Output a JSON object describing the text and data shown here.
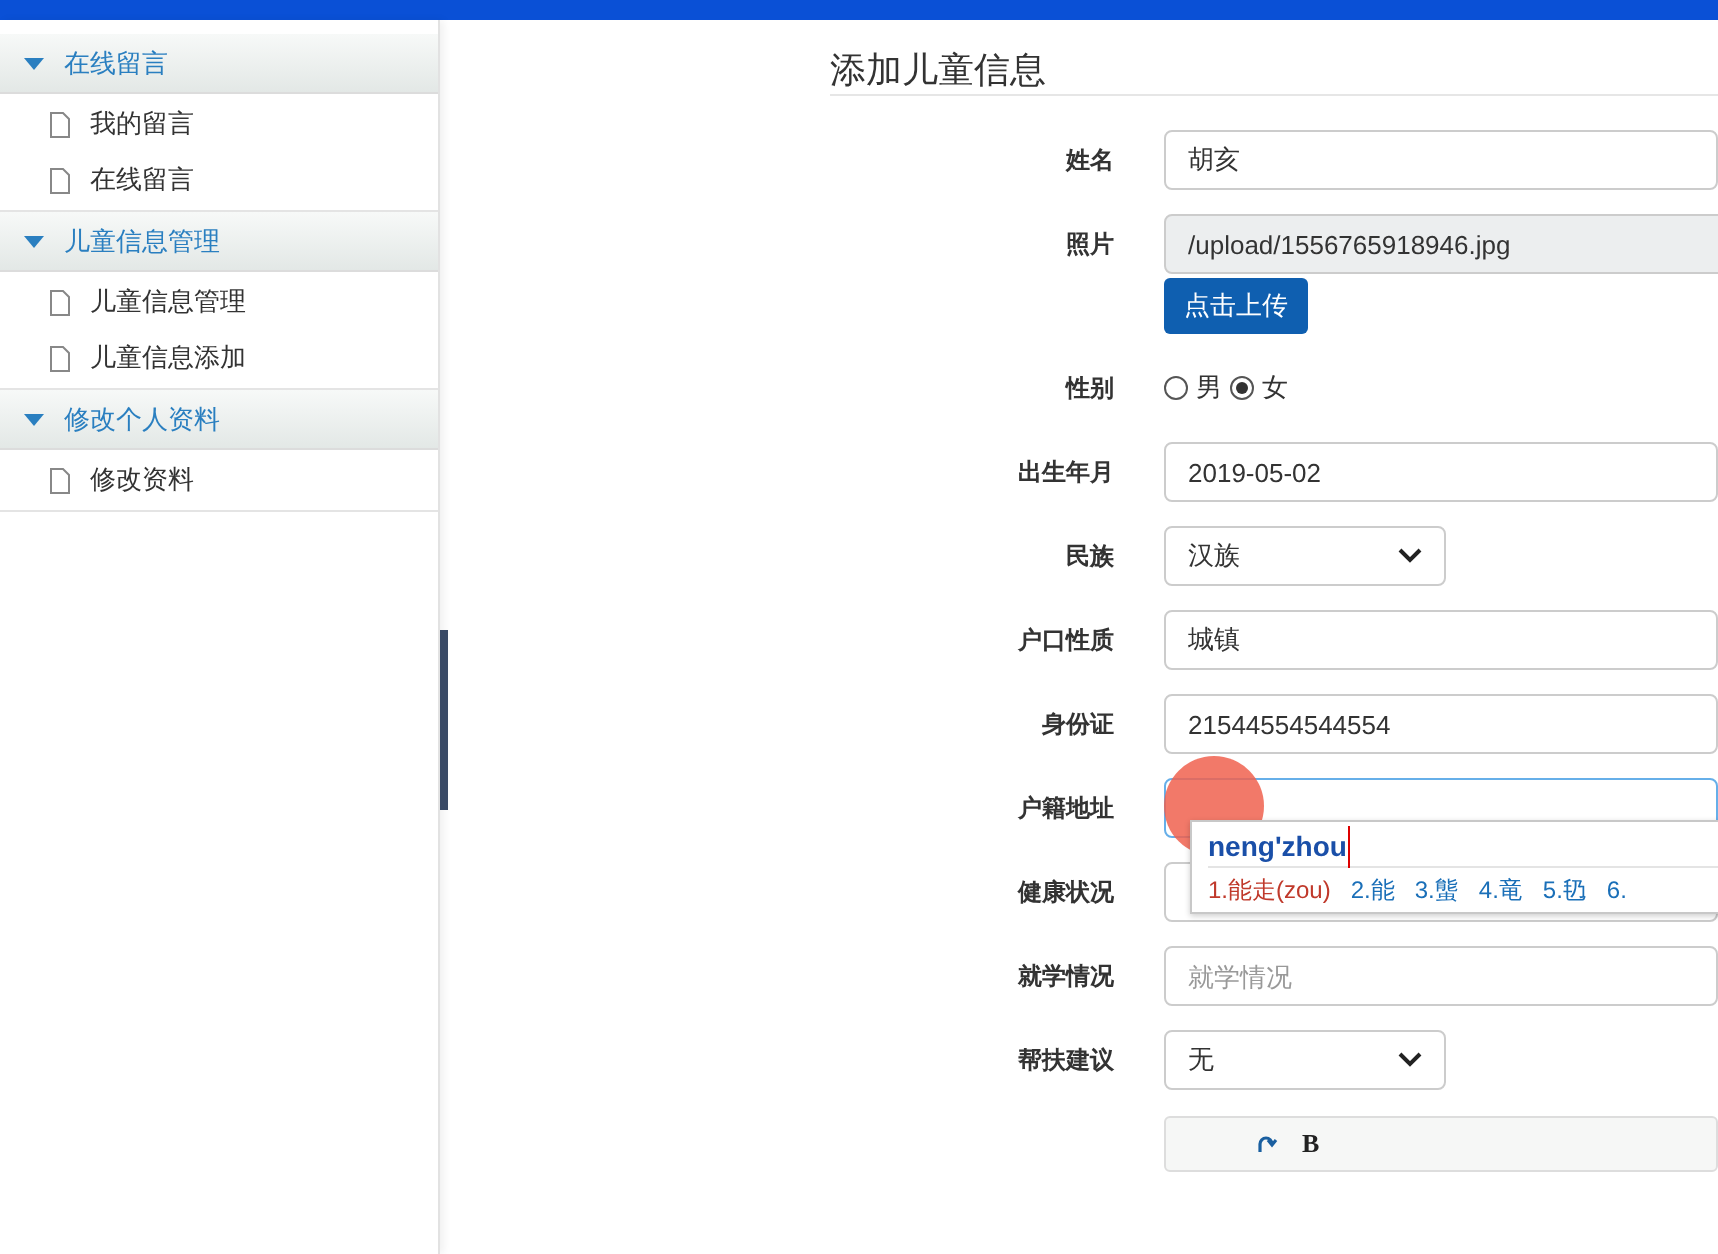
{
  "sidebar": {
    "groups": [
      {
        "title": "在线留言",
        "expanded": true,
        "items": [
          "我的留言",
          "在线留言"
        ]
      },
      {
        "title": "儿童信息管理",
        "expanded": true,
        "items": [
          "儿童信息管理",
          "儿童信息添加"
        ]
      },
      {
        "title": "修改个人资料",
        "expanded": true,
        "items": [
          "修改资料"
        ]
      }
    ]
  },
  "page_title": "添加儿童信息",
  "form": {
    "fields": [
      {
        "kind": "text",
        "label": "姓名",
        "value": "胡亥",
        "focused": false
      },
      {
        "kind": "file",
        "label": "照片",
        "value": "/upload/1556765918946.jpg",
        "button": "点击上传"
      },
      {
        "kind": "radio",
        "label": "性别",
        "options": [
          {
            "label": "男",
            "selected": false
          },
          {
            "label": "女",
            "selected": true
          }
        ]
      },
      {
        "kind": "text",
        "label": "出生年月",
        "value": "2019-05-02",
        "focused": false
      },
      {
        "kind": "select",
        "label": "民族",
        "value": "汉族"
      },
      {
        "kind": "text",
        "label": "户口性质",
        "value": "城镇",
        "focused": false
      },
      {
        "kind": "text",
        "label": "身份证",
        "value": "21544554544554",
        "focused": false
      },
      {
        "kind": "text",
        "label": "户籍地址",
        "focused": true
      },
      {
        "kind": "text",
        "label": "健康状况",
        "focused": false
      },
      {
        "kind": "text",
        "label": "就学情况",
        "placeholder": "就学情况",
        "focused": false
      },
      {
        "kind": "select",
        "label": "帮扶建议",
        "value": "无"
      },
      {
        "kind": "editor",
        "bold_button": "B"
      }
    ]
  },
  "ime": {
    "composition": "neng'zhou",
    "candidates": [
      {
        "label": "1.能走(zou)",
        "selected": true
      },
      {
        "label": "2.能",
        "selected": false
      },
      {
        "label": "3.螚",
        "selected": false
      },
      {
        "label": "4.竜",
        "selected": false
      },
      {
        "label": "5.㲌",
        "selected": false
      },
      {
        "label": "6.",
        "selected": false
      }
    ]
  }
}
